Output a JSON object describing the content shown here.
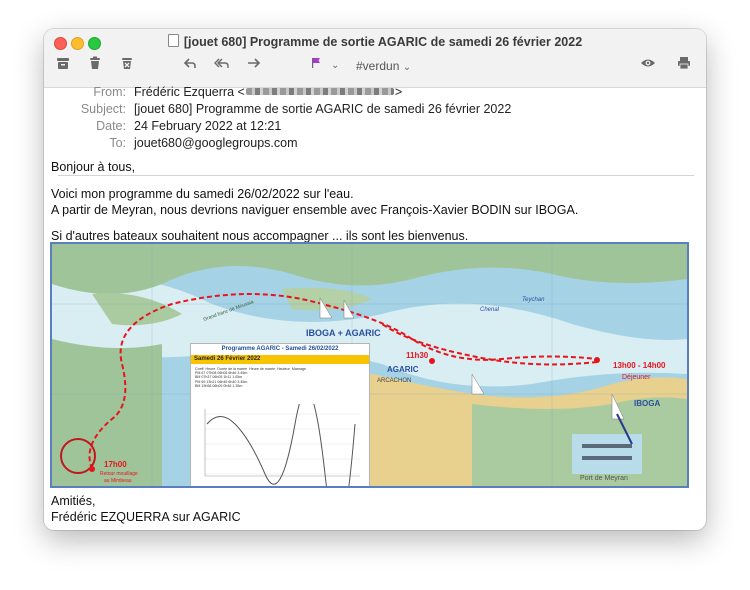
{
  "window": {
    "title": "[jouet 680] Programme de sortie AGARIC de samedi 26 février 2022",
    "flag_color": "#a23cd2",
    "tag_label": "#verdun"
  },
  "toolbar": {
    "archive_icon": "archive-icon",
    "delete_icon": "trash-icon",
    "junk_icon": "junk-icon",
    "reply_icon": "reply-icon",
    "reply_all_icon": "reply-all-icon",
    "forward_icon": "forward-icon",
    "flag_icon": "flag-icon",
    "view_icon": "eye-icon",
    "print_icon": "printer-icon"
  },
  "headers": {
    "from_label": "From:",
    "from_value": "Frédéric Ezquerra <",
    "from_value_end": ">",
    "subject_label": "Subject:",
    "subject_value": "[jouet 680] Programme de sortie AGARIC de samedi 26 février 2022",
    "date_label": "Date:",
    "date_value": "24 February 2022 at 12:21",
    "to_label": "To:",
    "to_value": "jouet680@googlegroups.com"
  },
  "body": {
    "greeting": "Bonjour à tous,",
    "p1": "Voici mon programme du samedi 26/02/2022 sur l'eau.",
    "p2": "A partir de Meyran, nous devrions naviguer ensemble avec François-Xavier BODIN sur IBOGA.",
    "p3": "Si d'autres bateaux souhaitent nous accompagner ... ils sont les bienvenus.",
    "signoff": "Amitiés,",
    "signature": "Frédéric EZQUERRA sur AGARIC"
  },
  "map": {
    "label_iboga_agaric": "IBOGA + AGARIC",
    "label_agaric": "AGARIC",
    "label_iboga": "IBOGA",
    "time_1130": "11h30",
    "time_1300": "13h00 - 14h00",
    "label_dejeuner": "Déjeuner",
    "time_1700": "17h00",
    "label_retour_1": "Retour mouillage",
    "label_retour_2": "au Mimbeau",
    "label_arcachon": "ARCACHON",
    "label_port_meyran": "Port de Meyran",
    "label_grand_banc": "Grand banc de Moussia",
    "label_chenal": "Chenal",
    "label_teychan": "Teychan",
    "route_color": "#e8141c",
    "card": {
      "title": "Programme AGARIC - Samedi 26/02/2022",
      "date_label": "Samedi 26 Février 2022",
      "table_header": [
        "Coeff",
        "Heure",
        "Durée de la marée",
        "Heure de marée",
        "Hauteur",
        "Marnage"
      ],
      "rows": [
        [
          "PM",
          "67",
          "07h08",
          "06h05",
          "6h46",
          "3.45m"
        ],
        [
          "BM",
          "",
          "07h37",
          "06h05",
          "1h11",
          "1.05m"
        ],
        [
          "PM",
          "69",
          "13h21",
          "06h45",
          "6h40",
          "3.45m"
        ],
        [
          "BM",
          "",
          "19h58",
          "06h09",
          "0h46",
          "1.35m"
        ]
      ]
    }
  }
}
